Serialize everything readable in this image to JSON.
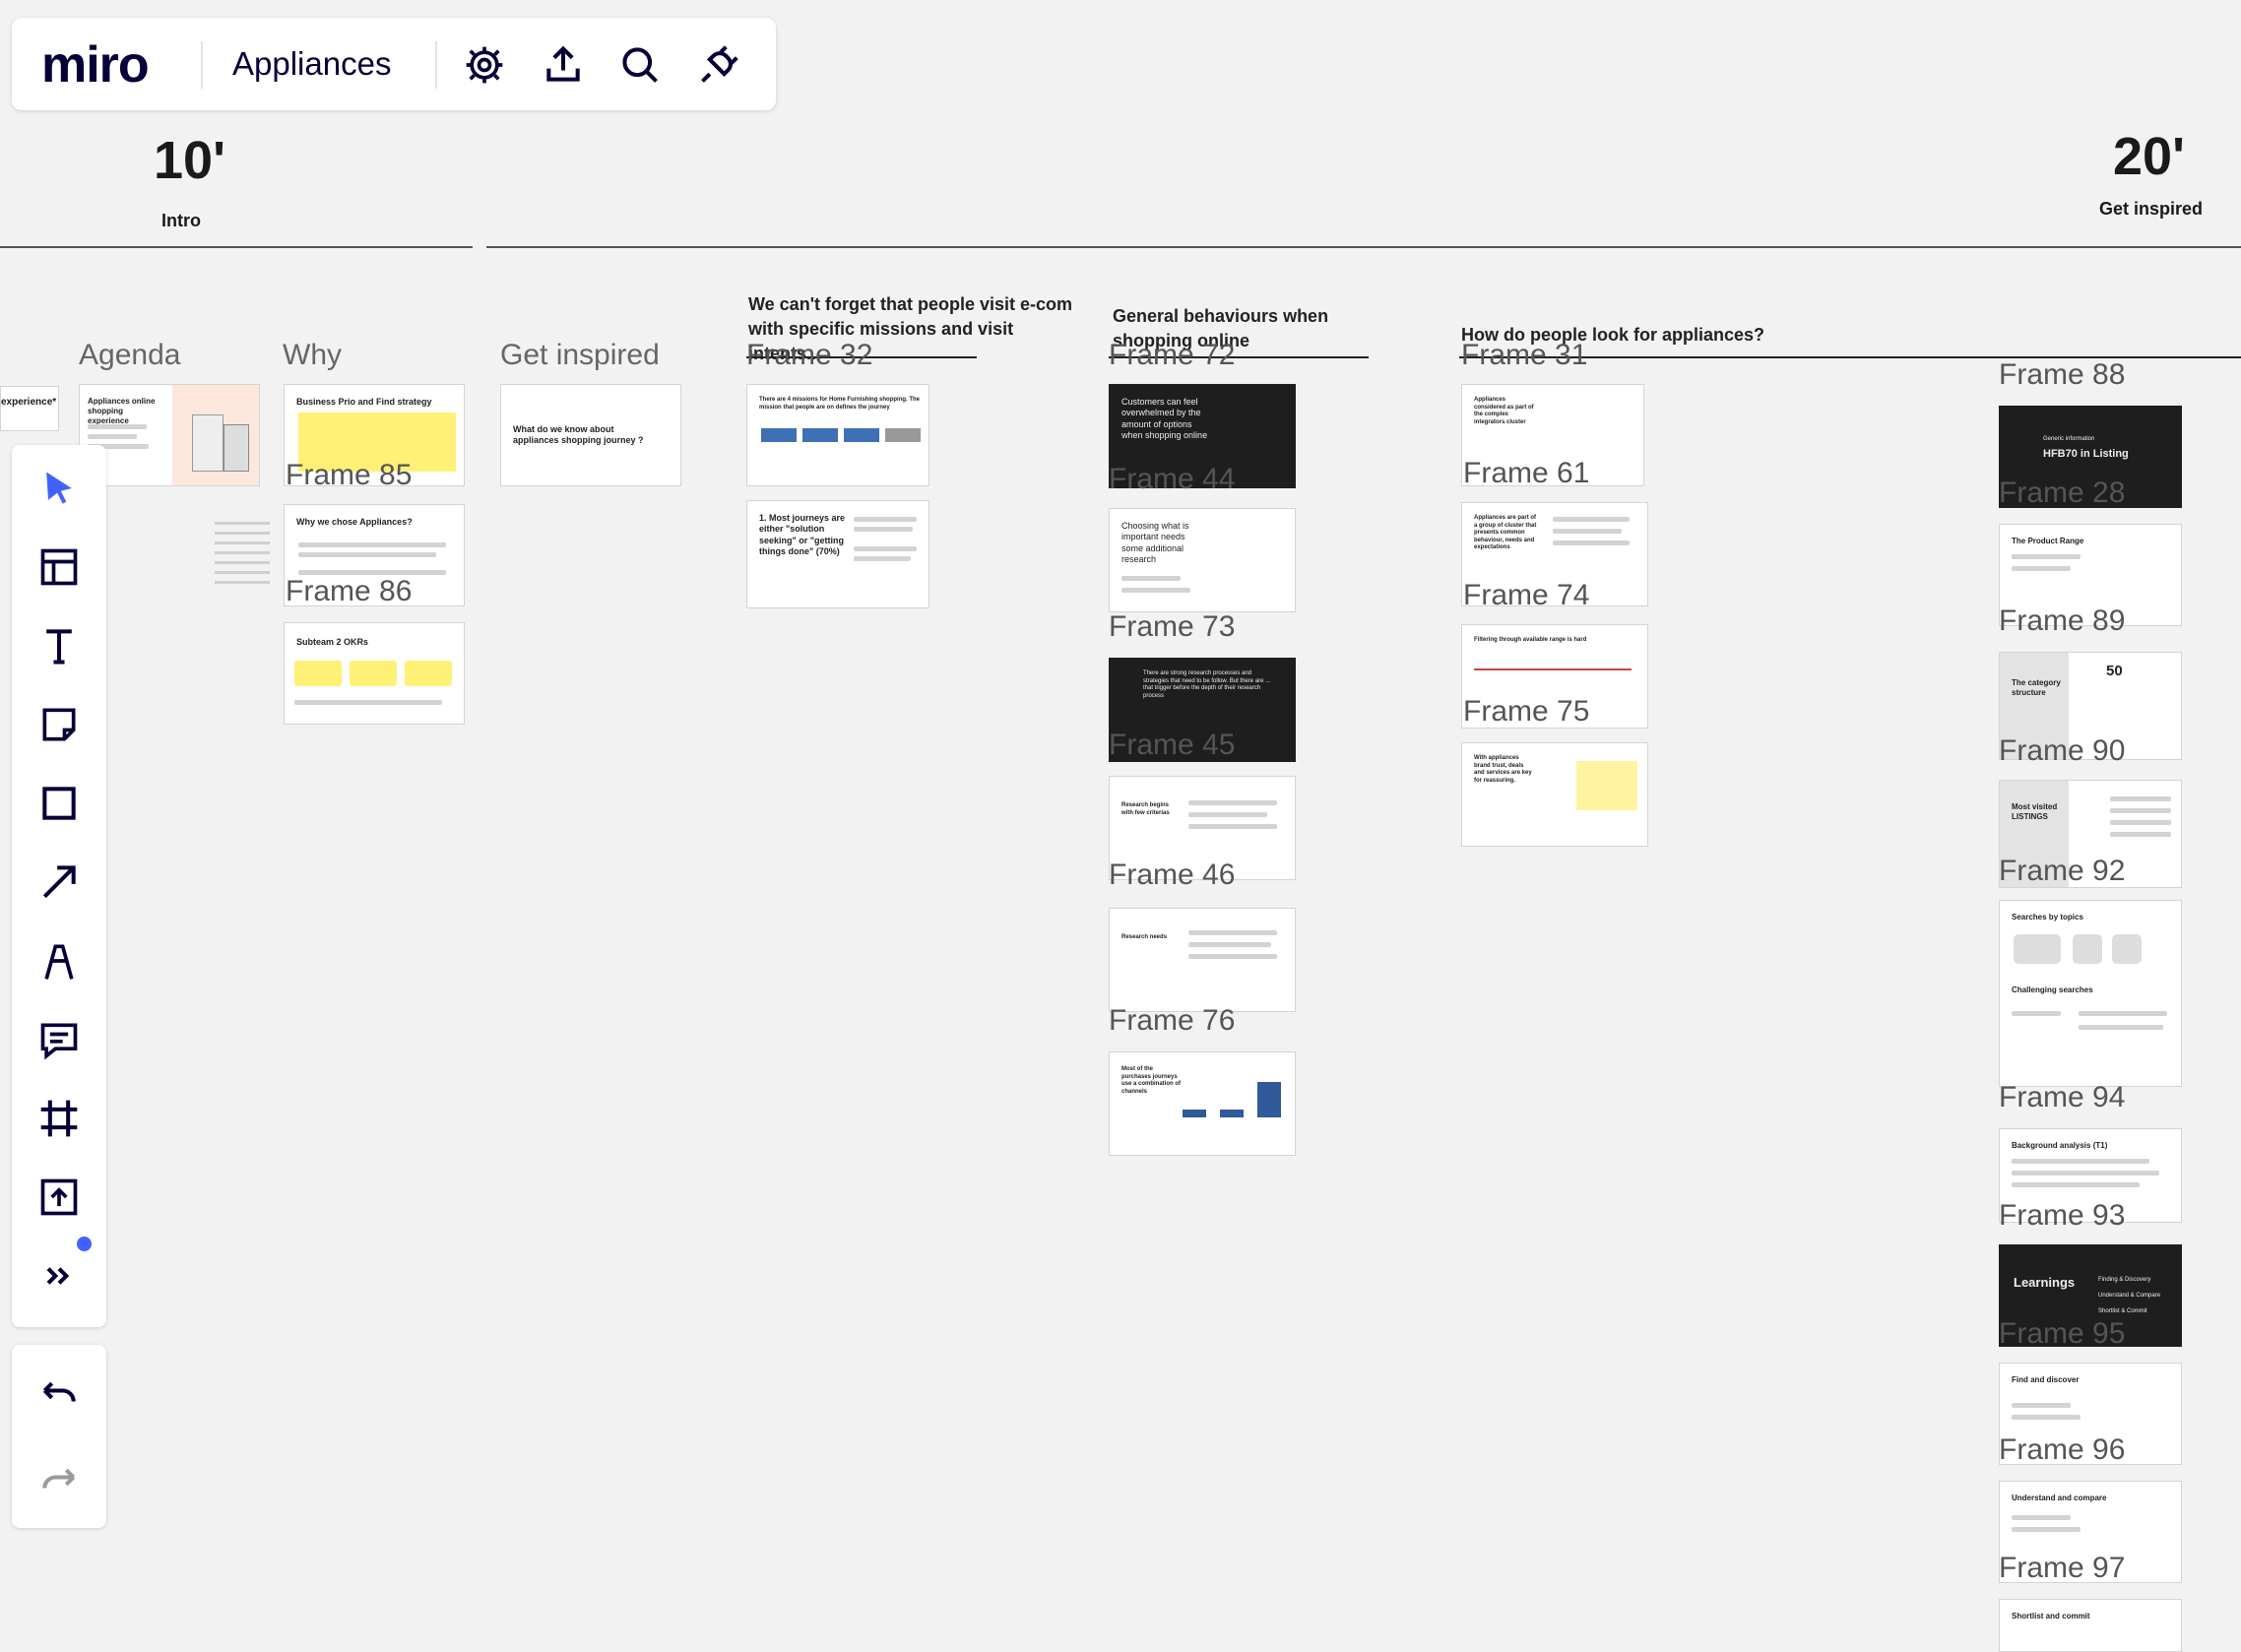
{
  "app": {
    "logo": "miro",
    "board_name": "Appliances"
  },
  "topbar_icons": [
    "settings-icon",
    "upload-icon",
    "search-icon",
    "integrations-icon"
  ],
  "left_toolbar": [
    "select-icon",
    "templates-icon",
    "text-icon",
    "sticky-note-icon",
    "shape-icon",
    "connector-icon",
    "pen-icon",
    "comment-icon",
    "frame-icon",
    "upload-icon",
    "more-tools-icon"
  ],
  "timers": [
    {
      "time": "10'",
      "label": "Intro"
    },
    {
      "time": "20'",
      "label": "Get inspired"
    }
  ],
  "columns": {
    "agenda": "Agenda",
    "why": "Why",
    "get_inspired": "Get inspired"
  },
  "sections": {
    "missions": "We can't forget that people visit e-com with specific missions and visit intents...",
    "behaviours": "General behaviours when shopping online",
    "look_for": "How do people look for appliances?"
  },
  "edge_fragment": "experience*",
  "frames": {
    "f32": "Frame 32",
    "f72": "Frame 72",
    "f31": "Frame 31",
    "f88": "Frame 88",
    "f85": "Frame 85",
    "f86": "Frame 86",
    "f44": "Frame 44",
    "f61": "Frame 61",
    "f28": "Frame 28",
    "f74": "Frame 74",
    "f89": "Frame 89",
    "f73": "Frame 73",
    "f75": "Frame 75",
    "f45": "Frame 45",
    "f90": "Frame 90",
    "f92": "Frame 92",
    "f46": "Frame 46",
    "f76": "Frame 76",
    "f94": "Frame 94",
    "f93": "Frame 93",
    "f95": "Frame 95",
    "f96": "Frame 96",
    "f97": "Frame 97"
  },
  "cards": {
    "agenda": "Appliances online shopping experience",
    "business": "Business Prio and Find strategy",
    "why_chose": "Why we chose Appliances?",
    "okrs": "Subteam 2 OKRs",
    "what_know": "What do we know about appliances shopping journey ?",
    "missions": "There are 4 missions for Home Furnishing shopping. The mission that people are on defines the journey",
    "journeys": "1. Most journeys are either \"solution seeking\" or \"getting things done\" (70%)",
    "overwhelmed": "Customers can feel overwhelmed by the amount of options when shopping online",
    "choosing": "Choosing what is important needs some additional research",
    "research_dark": "There are strong research processes and strategies that need to be follow. But there are ... that trigger before the depth of their research process",
    "research_begins": "Research begins with few criterias",
    "research_needs": "Research needs",
    "purchase_journeys": "Most of the purchases journeys use a combination of channels",
    "considered": "Appliances considered as part of the complex integrators cluster",
    "group_cluster": "Appliances are part of a group of cluster that presents common behaviour, needs and expectations",
    "filtering": "Filtering through available range is hard",
    "brand_trust": "With appliances brand trust, deals and services are key for reassuring.",
    "generic_info": "Generic information",
    "hfb70": "HFB70 in Listing",
    "product_range": "The Product Range",
    "category_structure": "The category structure",
    "category_count": "50",
    "most_visited": "Most visited LISTINGS",
    "searches_topics": "Searches by topics",
    "challenging": "Challenging searches",
    "background": "Background analysis (T1)",
    "learnings": "Learnings",
    "learn_items": [
      "Finding & Discovery",
      "Understand & Compare",
      "Shortlist & Commit"
    ],
    "find_discover": "Find and discover",
    "understand_compare": "Understand and compare",
    "shortlist_commit": "Shortlist and commit"
  },
  "colors": {
    "accent": "#4262ff",
    "sticky_yellow": "#fff176",
    "dark_card": "#1e1e1e",
    "canvas": "#f2f2f2"
  }
}
